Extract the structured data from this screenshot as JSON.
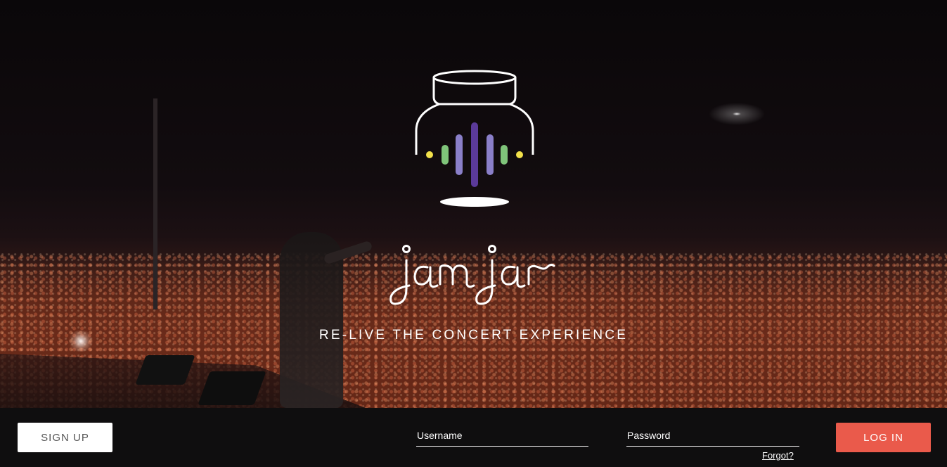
{
  "brand": {
    "name": "jamjar",
    "tagline": "RE-LIVE THE CONCERT EXPERIENCE",
    "logo_bar_colors": [
      "#f2e04a",
      "#7fc47a",
      "#8a7fc9",
      "#5b3a9a",
      "#8a7fc9",
      "#7fc47a",
      "#f2e04a"
    ]
  },
  "footer": {
    "signup_label": "SIGN UP",
    "username_placeholder": "Username",
    "password_placeholder": "Password",
    "forgot_label": "Forgot?",
    "login_label": "LOG IN"
  },
  "colors": {
    "accent": "#ea5a4b",
    "footer_bg": "#0f0e0f",
    "text": "#ffffff"
  }
}
